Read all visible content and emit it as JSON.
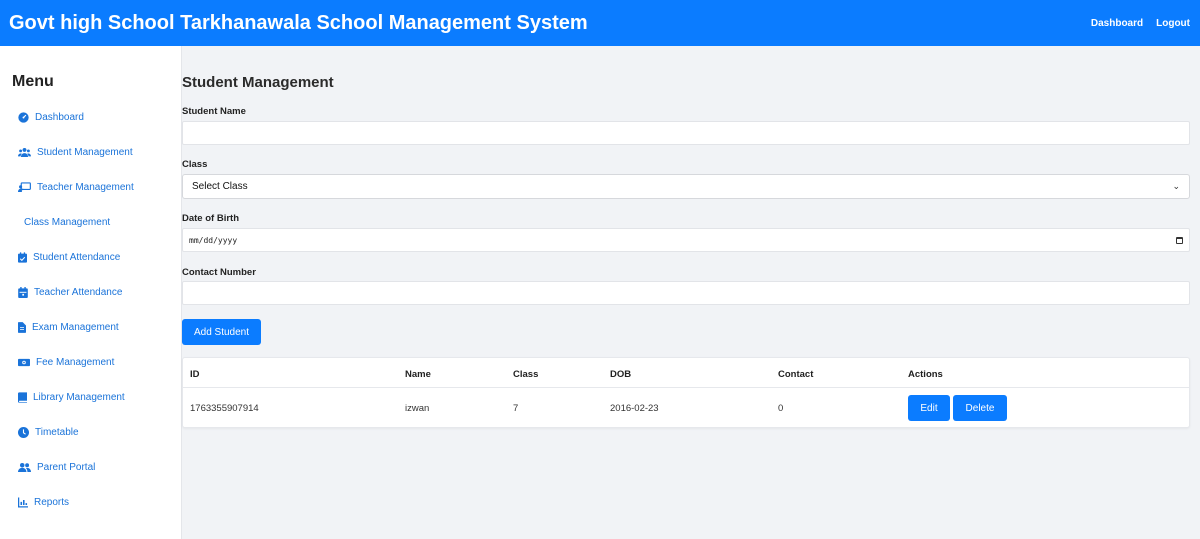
{
  "header": {
    "title": "Govt high School Tarkhanawala School Management System",
    "nav": [
      "Dashboard",
      "Logout"
    ]
  },
  "sidebar": {
    "title": "Menu",
    "items": [
      {
        "label": "Dashboard",
        "icon": "dashboard-icon"
      },
      {
        "label": "Student Management",
        "icon": "users-icon"
      },
      {
        "label": "Teacher Management",
        "icon": "chalkboard-teacher-icon"
      },
      {
        "label": "Class Management",
        "icon": ""
      },
      {
        "label": "Student Attendance",
        "icon": "calendar-check-icon"
      },
      {
        "label": "Teacher Attendance",
        "icon": "calendar-icon"
      },
      {
        "label": "Exam Management",
        "icon": "file-icon"
      },
      {
        "label": "Fee Management",
        "icon": "money-icon"
      },
      {
        "label": "Library Management",
        "icon": "book-icon"
      },
      {
        "label": "Timetable",
        "icon": "clock-icon"
      },
      {
        "label": "Parent Portal",
        "icon": "user-group-icon"
      },
      {
        "label": "Reports",
        "icon": "chart-icon"
      }
    ]
  },
  "main": {
    "title": "Student Management",
    "form": {
      "student_name_label": "Student Name",
      "student_name_value": "",
      "class_label": "Class",
      "class_selected": "Select Class",
      "dob_label": "Date of Birth",
      "dob_placeholder": "mm/dd/yyyy",
      "contact_label": "Contact Number",
      "contact_value": "",
      "submit_label": "Add Student"
    },
    "table": {
      "columns": [
        "ID",
        "Name",
        "Class",
        "DOB",
        "Contact",
        "Actions"
      ],
      "rows": [
        {
          "id": "1763355907914",
          "name": "izwan",
          "class": "7",
          "dob": "2016-02-23",
          "contact": "0",
          "edit_label": "Edit",
          "delete_label": "Delete"
        }
      ]
    }
  },
  "colors": {
    "primary": "#0b7cff",
    "link": "#1a73d9",
    "background": "#f1f3f6"
  }
}
